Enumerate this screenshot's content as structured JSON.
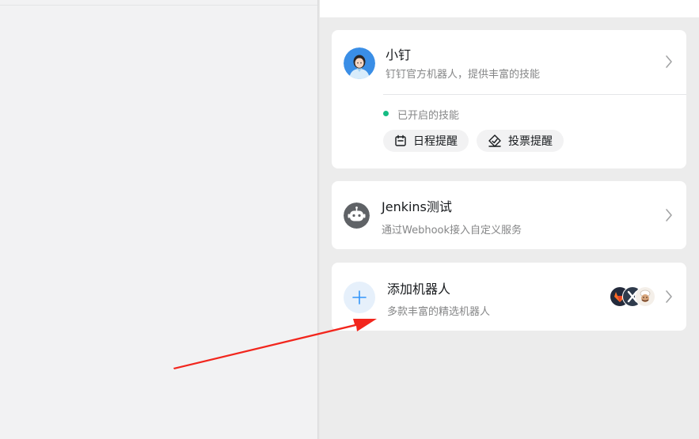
{
  "robots": [
    {
      "name": "小钉",
      "description": "钉钉官方机器人，提供丰富的技能",
      "avatar_icon": "woman-avatar-icon",
      "enabled_skills_label": "已开启的技能",
      "skills": [
        {
          "label": "日程提醒",
          "icon": "calendar-icon"
        },
        {
          "label": "投票提醒",
          "icon": "vote-icon"
        }
      ]
    },
    {
      "name": "Jenkins测试",
      "description": "通过Webhook接入自定义服务",
      "avatar_icon": "robot-icon"
    }
  ],
  "add_robot": {
    "title": "添加机器人",
    "description": "多款丰富的精选机器人",
    "icon": "plus-icon",
    "preview_avatars": [
      "gitlab-icon",
      "jenkins-icon",
      "chef-icon"
    ]
  },
  "colors": {
    "status_enabled": "#15bc83",
    "plus_accent": "#3296fa",
    "annotation_arrow": "#f2261d"
  }
}
